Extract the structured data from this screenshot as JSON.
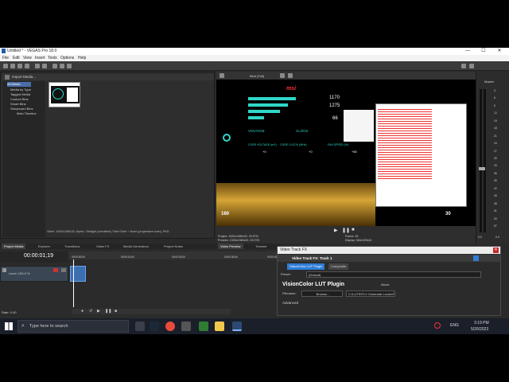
{
  "window": {
    "title": "Untitled * - VEGAS Pro 18.0",
    "controls": [
      "—",
      "☐",
      "✕"
    ]
  },
  "menu": [
    "File",
    "Edit",
    "View",
    "Insert",
    "Tools",
    "Options",
    "Help"
  ],
  "media_panel": {
    "header": "Import Media...",
    "tree": [
      "All Media",
      "Media by Type",
      "Tagged Media",
      "Custom Bins",
      "Smart Bins",
      "Storyboard Bins",
      "Main Timeline"
    ],
    "tabs": [
      "Project Media",
      "Explorer",
      "Transitions",
      "Video FX",
      "Media Generators",
      "Project Notes"
    ],
    "status": "Video: 1920x1080x32, Alpha = Straight (unmatted), Field Order = None (progressive scan), PNG"
  },
  "preview": {
    "quality": "Best (Full)",
    "brand": "msi",
    "stats": {
      "v1": "1170",
      "v2": "1275",
      "v3": "66"
    },
    "hud_labels": [
      "VOLTAGE",
      "CLOCK",
      "FAN",
      "CORE VOLTAGE (mV)",
      "CORE CLOCK (MHz)",
      "FAN SPEED (%)"
    ],
    "hud_values": [
      "+0",
      "+0",
      "+50"
    ],
    "ticker_left": "160",
    "ticker_right": "30",
    "project": "Project:   1920x1080x32, 29.970i",
    "preview_info": "Preview:  1920x1080x32, 29.970i",
    "frame": "Frame:    49",
    "display": "Display:  584x329x32",
    "tabs": [
      "Video Preview",
      "Trimmer"
    ]
  },
  "timeline": {
    "timecode": "00:00:01;19",
    "level": "Level: 100.0 %",
    "marks": [
      "00:00:00;00",
      "00:00:10;00",
      "00:00:20;00",
      "00:00:30;00",
      "00:00:40;00"
    ],
    "rate": "Rate: 0.00"
  },
  "mixer": {
    "label": "Master",
    "scale": [
      "3",
      "6",
      "9",
      "12",
      "15",
      "18",
      "21",
      "24",
      "27",
      "30",
      "33",
      "36",
      "39",
      "42",
      "45",
      "48",
      "51",
      "54",
      "57"
    ],
    "bottom": [
      "0.0",
      "0.0"
    ]
  },
  "fx_dialog": {
    "title": "Video Track FX",
    "subtitle": "Video Track FX: Track 1",
    "chain": [
      "VisionColor LUT Plugin",
      "Composite"
    ],
    "preset_label": "Preset:",
    "preset_value": "(Default)",
    "plugin_name": "VisionColor LUT Plugin",
    "about": "About",
    "filename_label": "Filename:",
    "browse": "Browse...",
    "path": "C:\\LUTS\\FLX Cinematic Looks\\F",
    "advanced": "Advanced"
  },
  "taskbar": {
    "search": "Type here to search",
    "lang": "ENG",
    "time": "3:19 PM",
    "date": "5/26/2023"
  },
  "colors": {
    "accent": "#2fd7c8",
    "selection": "#4b6ea8",
    "clip": "#3c6fb0"
  }
}
